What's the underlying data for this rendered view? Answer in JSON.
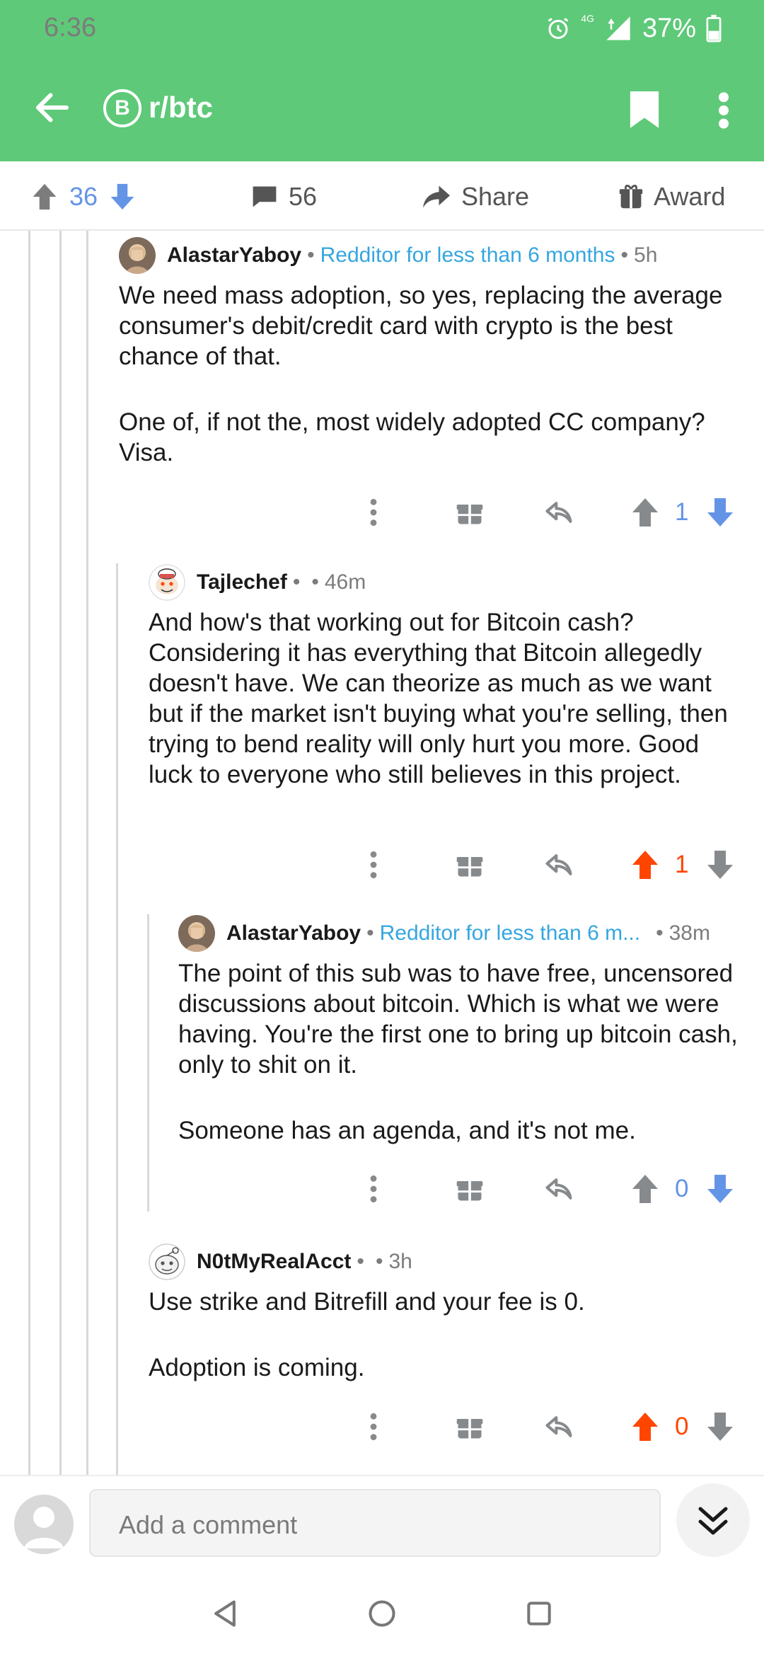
{
  "status_bar": {
    "time": "6:36",
    "network": "4G",
    "battery": "37%"
  },
  "app_bar": {
    "subreddit": "r/btc",
    "sub_icon_glyph": "B"
  },
  "post_actions": {
    "upvotes": "36",
    "comments": "56",
    "share_label": "Share",
    "award_label": "Award"
  },
  "comments": [
    {
      "author": "AlastarYaboy",
      "flair": "Redditor for less than 6 months",
      "time": "5h",
      "body": [
        "We need mass adoption, so yes, replacing the average consumer's debit/credit card with crypto is the best chance of that.",
        "One of, if not the, most widely adopted CC company? Visa."
      ],
      "score": "1",
      "vote_state": "none"
    },
    {
      "author": "Tajlechef",
      "flair": "",
      "time": "46m",
      "body": [
        "And how's that working out for Bitcoin cash? Considering it has everything that Bitcoin allegedly doesn't have. We can theorize as much as we want but if the market isn't buying what you're selling, then trying to bend reality will only hurt you more. Good luck to everyone who still believes in this project."
      ],
      "score": "1",
      "vote_state": "upvoted"
    },
    {
      "author": "AlastarYaboy",
      "flair": "Redditor for less than 6 m...",
      "time": "38m",
      "body": [
        "The point of this sub was to have free, uncensored discussions about bitcoin.  Which is what we were having.  You're the first one to bring up bitcoin cash, only to shit on it.",
        "Someone has an agenda, and it's not me."
      ],
      "score": "0",
      "vote_state": "none"
    },
    {
      "author": "N0tMyRealAcct",
      "flair": "",
      "time": "3h",
      "body": [
        "Use strike and Bitrefill and your fee is 0.",
        "Adoption is coming."
      ],
      "score": "0",
      "vote_state": "upvoted"
    }
  ],
  "composer": {
    "placeholder": "Add a comment"
  },
  "colors": {
    "brand": "#5ec978",
    "upvote": "#ff4500",
    "downvote_blue": "#6494e6",
    "flair": "#35a6df"
  },
  "icons": [
    "back-arrow-icon",
    "bitcoin-icon",
    "bookmark-icon",
    "more-vert-icon",
    "upvote-icon",
    "downvote-icon",
    "comment-icon",
    "share-icon",
    "award-icon",
    "reply-icon",
    "gift-icon",
    "chevrons-down-icon"
  ]
}
